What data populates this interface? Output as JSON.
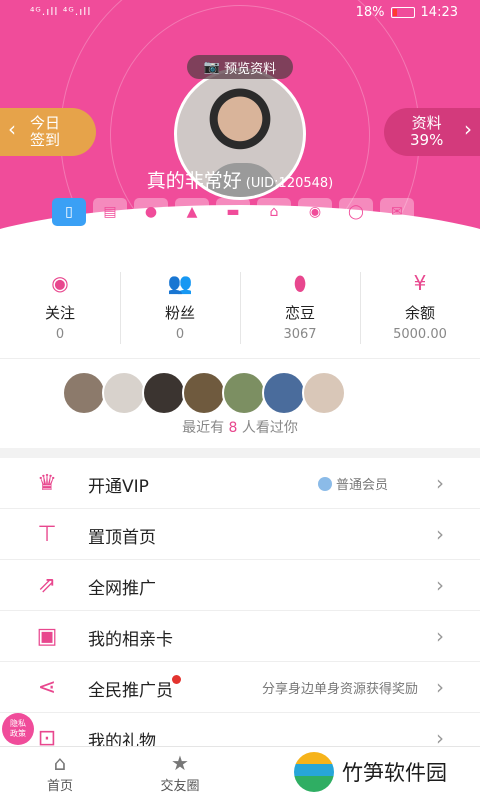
{
  "status": {
    "signal_text": "⁴ᴳ.ıll ⁴ᴳ.ıll",
    "battery": "18%",
    "time": "14:23"
  },
  "profile": {
    "preview_label": "预览资料",
    "checkin_line1": "今日",
    "checkin_line2": "签到",
    "info_line1": "资料",
    "info_line2": "39%",
    "name": "真的非常好",
    "uid": "(UID:120548)",
    "verify_icons": [
      "phone-icon",
      "id-card-icon",
      "person-icon",
      "graduation-icon",
      "car-icon",
      "house-icon",
      "wechat-icon",
      "qq-icon",
      "mail-icon"
    ]
  },
  "stats": [
    {
      "label": "关注",
      "value": "0",
      "icon": "eye-icon"
    },
    {
      "label": "粉丝",
      "value": "0",
      "icon": "fans-icon"
    },
    {
      "label": "恋豆",
      "value": "3067",
      "icon": "bean-icon"
    },
    {
      "label": "余额",
      "value": "5000.00",
      "icon": "yen-icon"
    }
  ],
  "viewers": {
    "prefix": "最近有",
    "count": "8",
    "suffix": "人看过你"
  },
  "menu": [
    {
      "label": "开通VIP",
      "badge": "普通会员",
      "icon": "crown-icon"
    },
    {
      "label": "置顶首页",
      "icon": "top-icon"
    },
    {
      "label": "全网推广",
      "icon": "share-icon"
    },
    {
      "label": "我的相亲卡",
      "icon": "card-icon"
    },
    {
      "label": "全民推广员",
      "extra": "分享身边单身资源获得奖励",
      "icon": "network-icon"
    },
    {
      "label": "我的礼物",
      "icon": "gift-icon"
    }
  ],
  "privacy": {
    "line1": "隐私",
    "line2": "政策"
  },
  "tabs": [
    {
      "label": "首页"
    },
    {
      "label": "交友圈"
    }
  ],
  "brand": {
    "text": "竹笋软件园"
  },
  "colors": {
    "accent": "#f04c9a",
    "checkin": "#e6a34a",
    "active_icon": "#3aa0f5"
  }
}
